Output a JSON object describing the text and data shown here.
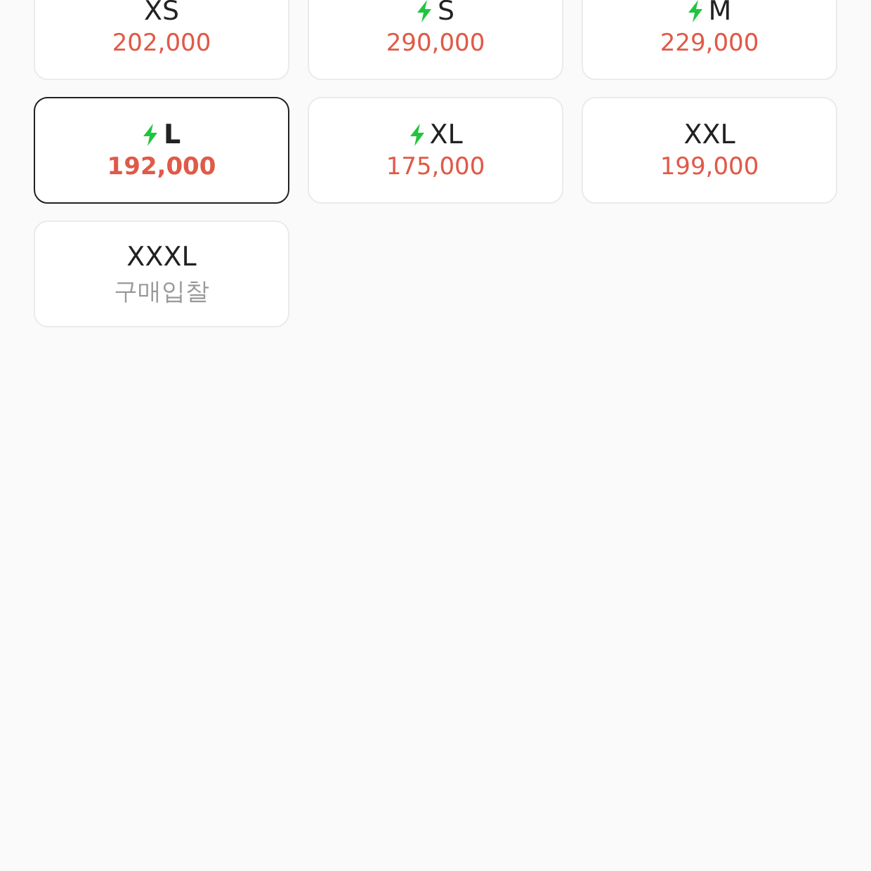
{
  "sizes": [
    {
      "size": "XS",
      "express": false,
      "selected": false,
      "price": "202,000",
      "kind": "price"
    },
    {
      "size": "S",
      "express": true,
      "selected": false,
      "price": "290,000",
      "kind": "price"
    },
    {
      "size": "M",
      "express": true,
      "selected": false,
      "price": "229,000",
      "kind": "price"
    },
    {
      "size": "L",
      "express": true,
      "selected": true,
      "price": "192,000",
      "kind": "price"
    },
    {
      "size": "XL",
      "express": true,
      "selected": false,
      "price": "175,000",
      "kind": "price"
    },
    {
      "size": "XXL",
      "express": false,
      "selected": false,
      "price": "199,000",
      "kind": "price"
    },
    {
      "size": "XXXL",
      "express": false,
      "selected": false,
      "price": "구매입찰",
      "kind": "bid"
    }
  ]
}
